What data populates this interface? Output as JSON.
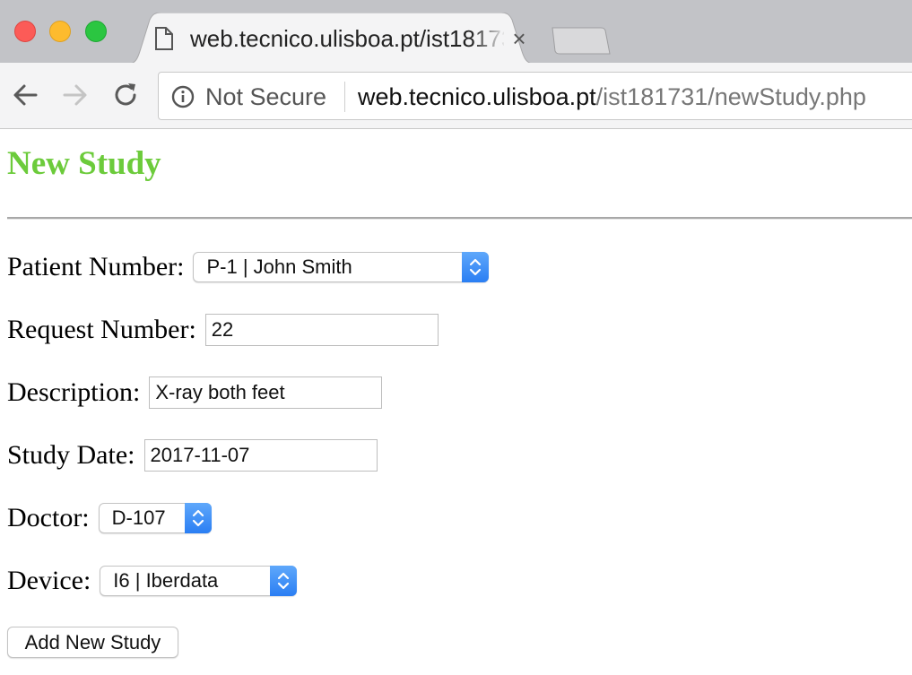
{
  "browser": {
    "tab_title": "web.tecnico.ulisboa.pt/ist181731/newStudy.php",
    "tab_close_glyph": "×",
    "security_label": "Not Secure",
    "url_host": "web.tecnico.ulisboa.pt",
    "url_path": "/ist181731/newStudy.php",
    "icons": [
      "page-icon",
      "close-icon",
      "back-icon",
      "forward-icon",
      "reload-icon",
      "info-icon"
    ],
    "traffic_light_colors": {
      "close": "#fc5b57",
      "minimize": "#fdbb2e",
      "maximize": "#2bc641"
    }
  },
  "page": {
    "title": "New Study",
    "title_color": "#6ccb3b"
  },
  "form": {
    "patient": {
      "label": "Patient Number:",
      "selected": "P-1 | John Smith"
    },
    "request": {
      "label": "Request Number:",
      "value": "22"
    },
    "description": {
      "label": "Description:",
      "value": "X-ray both feet"
    },
    "date": {
      "label": "Study Date:",
      "value": "2017-11-07"
    },
    "doctor": {
      "label": "Doctor:",
      "selected": "D-107"
    },
    "device": {
      "label": "Device:",
      "selected": "I6 | Iberdata"
    },
    "submit_label": "Add New Study"
  }
}
